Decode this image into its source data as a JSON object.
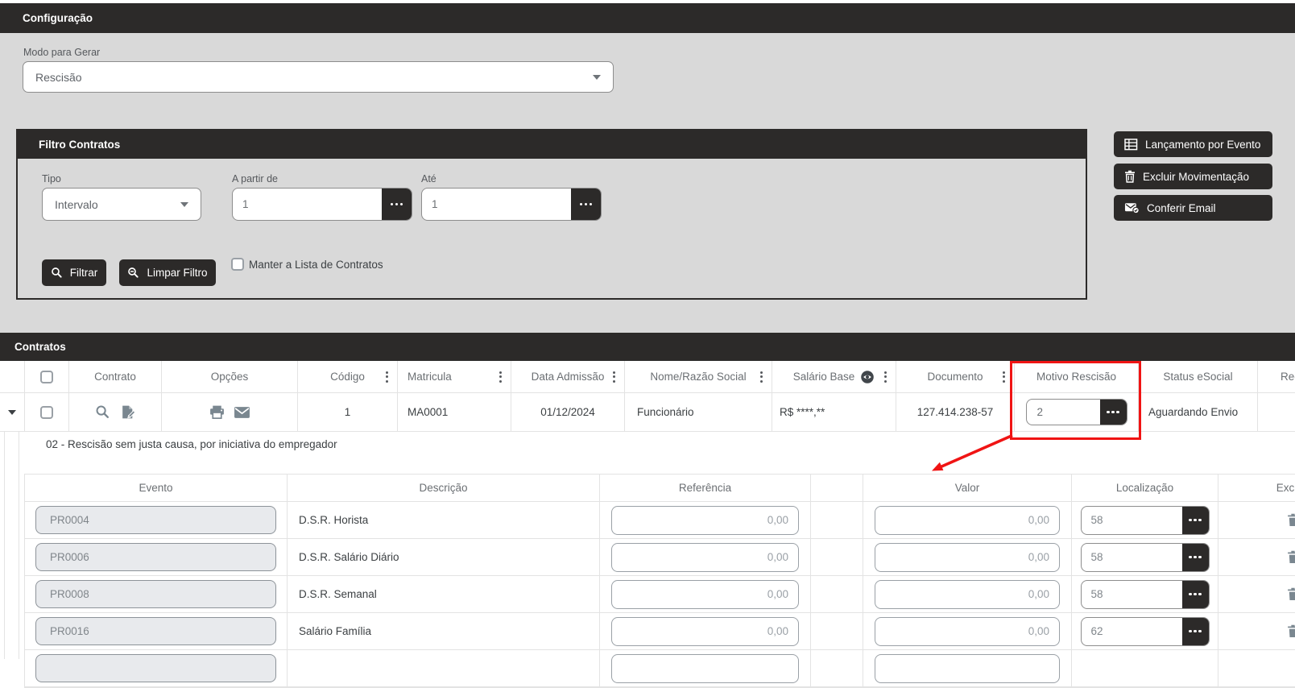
{
  "titlebar": {
    "title": "Configuração"
  },
  "config": {
    "modo_label": "Modo para Gerar",
    "modo_value": "Rescisão"
  },
  "filter": {
    "title": "Filtro Contratos",
    "tipo_label": "Tipo",
    "tipo_value": "Intervalo",
    "from_label": "A partir de",
    "from_value": "1",
    "to_label": "Até",
    "to_value": "1",
    "filtrar_label": "Filtrar",
    "limpar_label": "Limpar Filtro",
    "keep_list_label": "Manter a Lista de Contratos"
  },
  "actions": {
    "lancamento_label": "Lançamento por Evento",
    "excluir_label": "Excluir Movimentação",
    "conferir_label": "Conferir Email"
  },
  "contracts": {
    "title": "Contratos",
    "columns": {
      "contrato": "Contrato",
      "opcoes": "Opções",
      "codigo": "Código",
      "matricula": "Matricula",
      "data_admissao": "Data Admissão",
      "nome": "Nome/Razão Social",
      "salario": "Salário Base",
      "documento": "Documento",
      "motivo": "Motivo Rescisão",
      "status": "Status eSocial",
      "recibo": "Recibo"
    },
    "row": {
      "codigo": "1",
      "matricula": "MA0001",
      "data_admissao": "01/12/2024",
      "nome": "Funcionário",
      "salario": "R$ ****,**",
      "documento": "127.414.238-57",
      "motivo": "2",
      "status": "Aguardando Envio"
    }
  },
  "detail": {
    "motivo_descricao": "02 - Rescisão sem justa causa, por iniciativa do empregador",
    "columns": {
      "evento": "Evento",
      "descricao": "Descrição",
      "referencia": "Referência",
      "valor": "Valor",
      "localizacao": "Localização",
      "excluir": "Excluir"
    },
    "rows": [
      {
        "evento": "PR0004",
        "descricao": "D.S.R. Horista",
        "referencia": "0,00",
        "valor": "0,00",
        "localizacao": "58"
      },
      {
        "evento": "PR0006",
        "descricao": "D.S.R. Salário Diário",
        "referencia": "0,00",
        "valor": "0,00",
        "localizacao": "58"
      },
      {
        "evento": "PR0008",
        "descricao": "D.S.R. Semanal",
        "referencia": "0,00",
        "valor": "0,00",
        "localizacao": "58"
      },
      {
        "evento": "PR0016",
        "descricao": "Salário Família",
        "referencia": "0,00",
        "valor": "0,00",
        "localizacao": "62"
      },
      {
        "evento": "",
        "descricao": "",
        "referencia": "",
        "valor": "",
        "localizacao": ""
      }
    ]
  },
  "icons": {
    "filtrar": "search-icon",
    "limpar": "search-minus-icon",
    "lancamento": "table-grid-icon",
    "excluir": "trash-icon",
    "conferir": "mail-check-icon",
    "contrato_cell": [
      "search-icon",
      "edit-document-icon"
    ],
    "opcoes_cell": [
      "printer-icon",
      "envelope-icon"
    ],
    "salario_header": "visibility-eye-icon",
    "column_menu": "kebab-menu-icon",
    "lookup": "ellipsis-lookup-icon",
    "row_delete": "trash-icon",
    "expand": "caret-down-icon"
  },
  "colors": {
    "dark_bar": "#2c2a29",
    "accent_red": "#f01414",
    "page_gray": "#d9d9d9"
  }
}
